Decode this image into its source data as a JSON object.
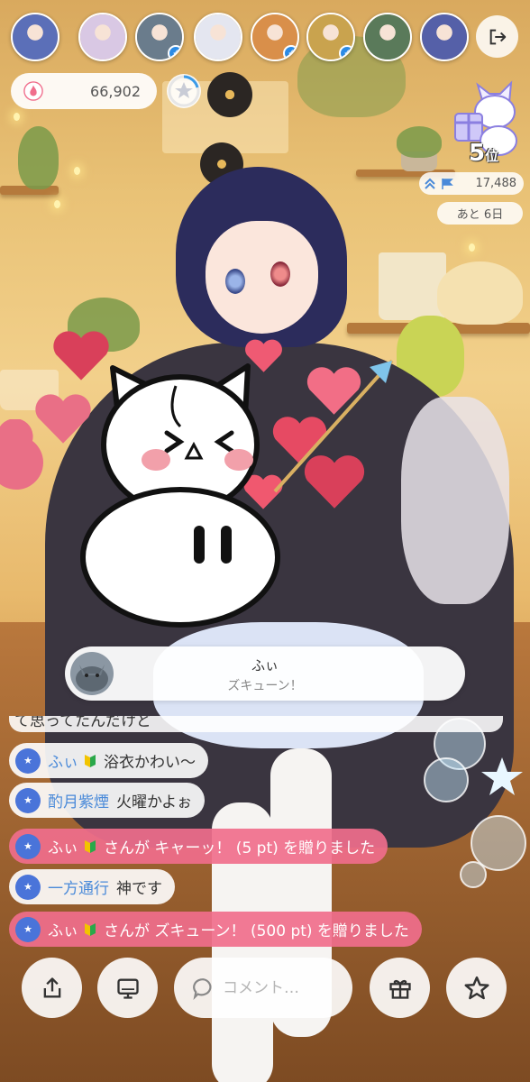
{
  "viewers": [
    {
      "name": "viewer-1",
      "verified": false,
      "color": "#5b6fb8"
    },
    {
      "name": "viewer-2",
      "verified": false,
      "color": "#d9c8e4"
    },
    {
      "name": "viewer-3",
      "verified": true,
      "color": "#6a7c8c"
    },
    {
      "name": "viewer-4",
      "verified": false,
      "color": "#e4e6f0"
    },
    {
      "name": "viewer-5",
      "verified": true,
      "color": "#d98f4a"
    },
    {
      "name": "viewer-6",
      "verified": true,
      "color": "#c9a34e"
    },
    {
      "name": "viewer-7",
      "verified": false,
      "color": "#5a7a5a"
    },
    {
      "name": "viewer-8",
      "verified": false,
      "color": "#5560a8"
    }
  ],
  "stats": {
    "points": "66,902",
    "rank_number": "5",
    "rank_suffix": "位",
    "score": "17,488",
    "remaining": "あと 6日"
  },
  "gift_notice": {
    "sender": "ふぃ",
    "gift": "ズキューン！"
  },
  "chat": {
    "cut_off_text": "て思ってたんだけど",
    "messages": [
      {
        "type": "comment",
        "name": "ふぃ",
        "beginner": true,
        "text": "浴衣かわい〜"
      },
      {
        "type": "comment",
        "name": "酌月紫煙",
        "beginner": false,
        "text": "火曜かよぉ"
      },
      {
        "type": "gift",
        "name": "ふぃ",
        "beginner": true,
        "text": "さんが キャーッ！ (5 pt) を贈りました"
      },
      {
        "type": "comment",
        "name": "一方通行",
        "beginner": false,
        "text": "神です"
      },
      {
        "type": "gift",
        "name": "ふぃ",
        "beginner": true,
        "text": "さんが ズキューン！ (500 pt) を贈りました"
      }
    ]
  },
  "bottom_bar": {
    "comment_placeholder": "コメント…",
    "buttons": [
      "share-icon",
      "screen-icon",
      "gift-icon",
      "star-icon"
    ]
  },
  "colors": {
    "gift_message_bg": "#f06e8c",
    "chat_name": "#4a8ad9",
    "user_badge": "#4a74d9",
    "verified": "#2b8be6"
  }
}
